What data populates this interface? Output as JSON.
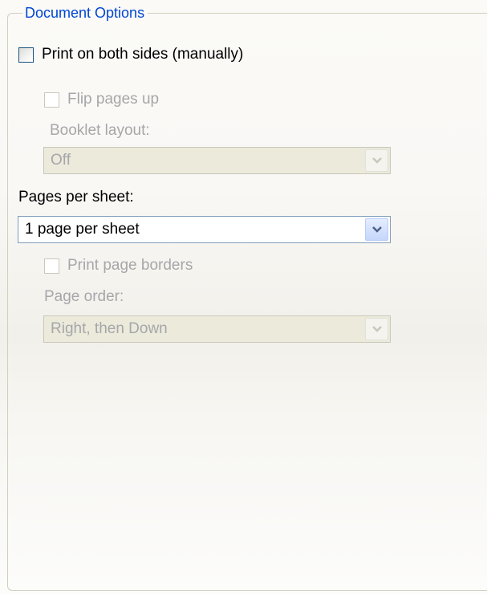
{
  "group": {
    "title": "Document Options"
  },
  "print_both_sides": {
    "label": "Print on both sides (manually)",
    "checked": false
  },
  "flip_pages": {
    "label": "Flip pages up",
    "checked": false,
    "enabled": false
  },
  "booklet": {
    "label": "Booklet layout:",
    "value": "Off",
    "enabled": false
  },
  "pages_per_sheet": {
    "label": "Pages per sheet:",
    "value": "1 page per sheet",
    "enabled": true
  },
  "page_borders": {
    "label": "Print page borders",
    "checked": false,
    "enabled": false
  },
  "page_order": {
    "label": "Page order:",
    "value": "Right, then Down",
    "enabled": false
  },
  "icons": {
    "dropdown": "chevron-down-icon"
  },
  "colors": {
    "group_title": "#0046d5",
    "disabled_text": "#a7a6aa",
    "combo_border": "#7f9db9",
    "arrow_active": "#4d6185",
    "arrow_disabled": "#c9c7ba"
  }
}
